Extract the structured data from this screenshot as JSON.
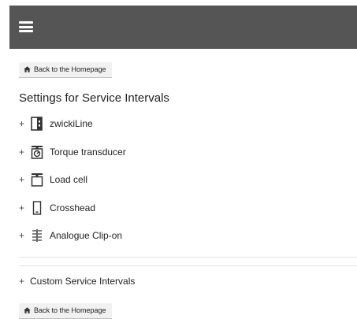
{
  "header": {
    "menu_icon": "hamburger-menu-icon",
    "background": "#555555"
  },
  "back_button": {
    "label": "Back to the Homepage",
    "icon": "home-icon"
  },
  "page": {
    "title": "Settings for Service Intervals"
  },
  "device_list": [
    {
      "expand": "+",
      "icon": "zwickiline-machine-icon",
      "label": "zwickiLine"
    },
    {
      "expand": "+",
      "icon": "torque-transducer-icon",
      "label": "Torque transducer"
    },
    {
      "expand": "+",
      "icon": "load-cell-icon",
      "label": "Load cell"
    },
    {
      "expand": "+",
      "icon": "crosshead-icon",
      "label": "Crosshead"
    },
    {
      "expand": "+",
      "icon": "clip-on-extensometer-icon",
      "label": "Analogue Clip-on"
    }
  ],
  "custom_intervals": {
    "expand": "+",
    "label": "Custom Service Intervals"
  }
}
